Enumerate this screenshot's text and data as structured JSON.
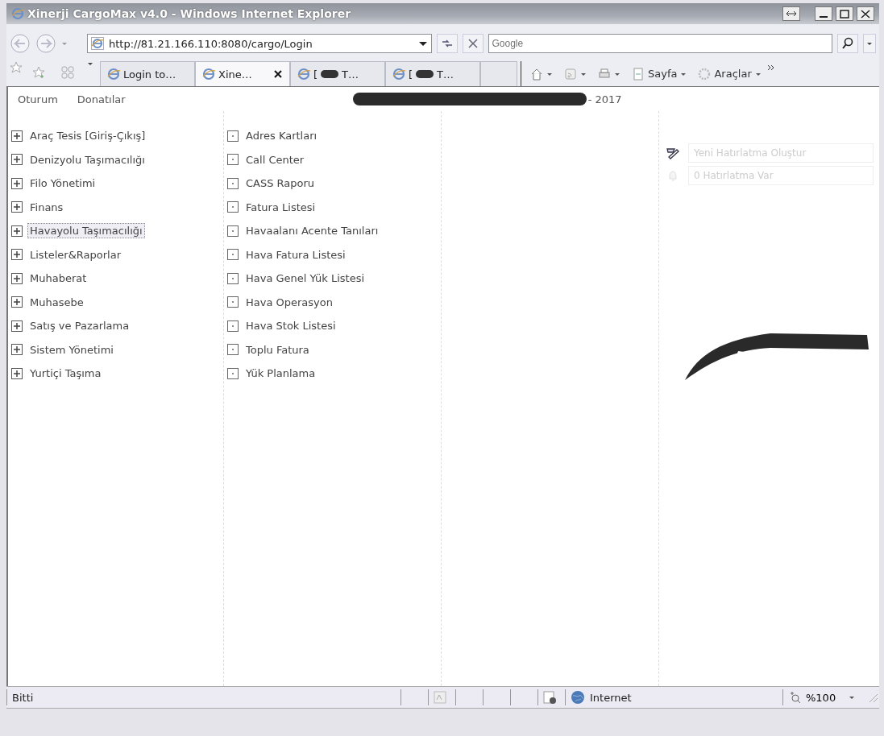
{
  "window": {
    "title": "Xinerji CargoMax v4.0 - Windows Internet Explorer"
  },
  "address_bar": {
    "url": "http://81.21.166.110:8080/cargo/Login"
  },
  "search": {
    "placeholder": "Google"
  },
  "tabs": [
    {
      "kind": "page",
      "label": "Login to…",
      "selected": false
    },
    {
      "kind": "page",
      "label": "Xine…",
      "selected": true
    },
    {
      "kind": "redacted",
      "label_start": "[",
      "label_end": "T…",
      "selected": false
    },
    {
      "kind": "redacted",
      "label_start": "[",
      "label_end": "T…",
      "selected": false
    },
    {
      "kind": "new",
      "selected": false
    }
  ],
  "command_bar": [
    {
      "kind": "home"
    },
    {
      "kind": "feeds"
    },
    {
      "kind": "print"
    },
    {
      "kind": "page",
      "label": "Sayfa"
    },
    {
      "kind": "tools",
      "label": "Araçlar"
    }
  ],
  "menu": [
    {
      "label": "Oturum"
    },
    {
      "label": "Donatılar"
    }
  ],
  "page_title_suffix": "- 2017",
  "modules": [
    {
      "label": "Araç Tesis [Giriş-Çıkış]",
      "expanded": false,
      "selected": false
    },
    {
      "label": "Denizyolu Taşımacılığı",
      "expanded": false,
      "selected": false
    },
    {
      "label": "Filo Yönetimi",
      "expanded": false,
      "selected": false
    },
    {
      "label": "Finans",
      "expanded": false,
      "selected": false
    },
    {
      "label": "Havayolu Taşımacılığı",
      "expanded": false,
      "selected": true
    },
    {
      "label": "Listeler&Raporlar",
      "expanded": false,
      "selected": false
    },
    {
      "label": "Muhaberat",
      "expanded": false,
      "selected": false
    },
    {
      "label": "Muhasebe",
      "expanded": false,
      "selected": false
    },
    {
      "label": "Satış ve Pazarlama",
      "expanded": false,
      "selected": false
    },
    {
      "label": "Sistem Yönetimi",
      "expanded": false,
      "selected": false
    },
    {
      "label": "Yurtiçi Taşıma",
      "expanded": false,
      "selected": false
    }
  ],
  "submenu": [
    {
      "label": "Adres Kartları"
    },
    {
      "label": "Call Center"
    },
    {
      "label": "CASS Raporu"
    },
    {
      "label": "Fatura Listesi"
    },
    {
      "label": "Havaalanı Acente Tanıları"
    },
    {
      "label": "Hava Fatura Listesi"
    },
    {
      "label": "Hava Genel Yük Listesi"
    },
    {
      "label": "Hava Operasyon"
    },
    {
      "label": "Hava Stok Listesi"
    },
    {
      "label": "Toplu Fatura"
    },
    {
      "label": "Yük Planlama"
    }
  ],
  "reminders": [
    {
      "kind": "create",
      "label": "Yeni Hatırlatma Oluştur",
      "disabled": true
    },
    {
      "kind": "count",
      "label": "0 Hatırlatma Var",
      "disabled": true
    }
  ],
  "status_bar": {
    "text": "Bitti",
    "zone": "Internet",
    "zoom": "%100"
  }
}
